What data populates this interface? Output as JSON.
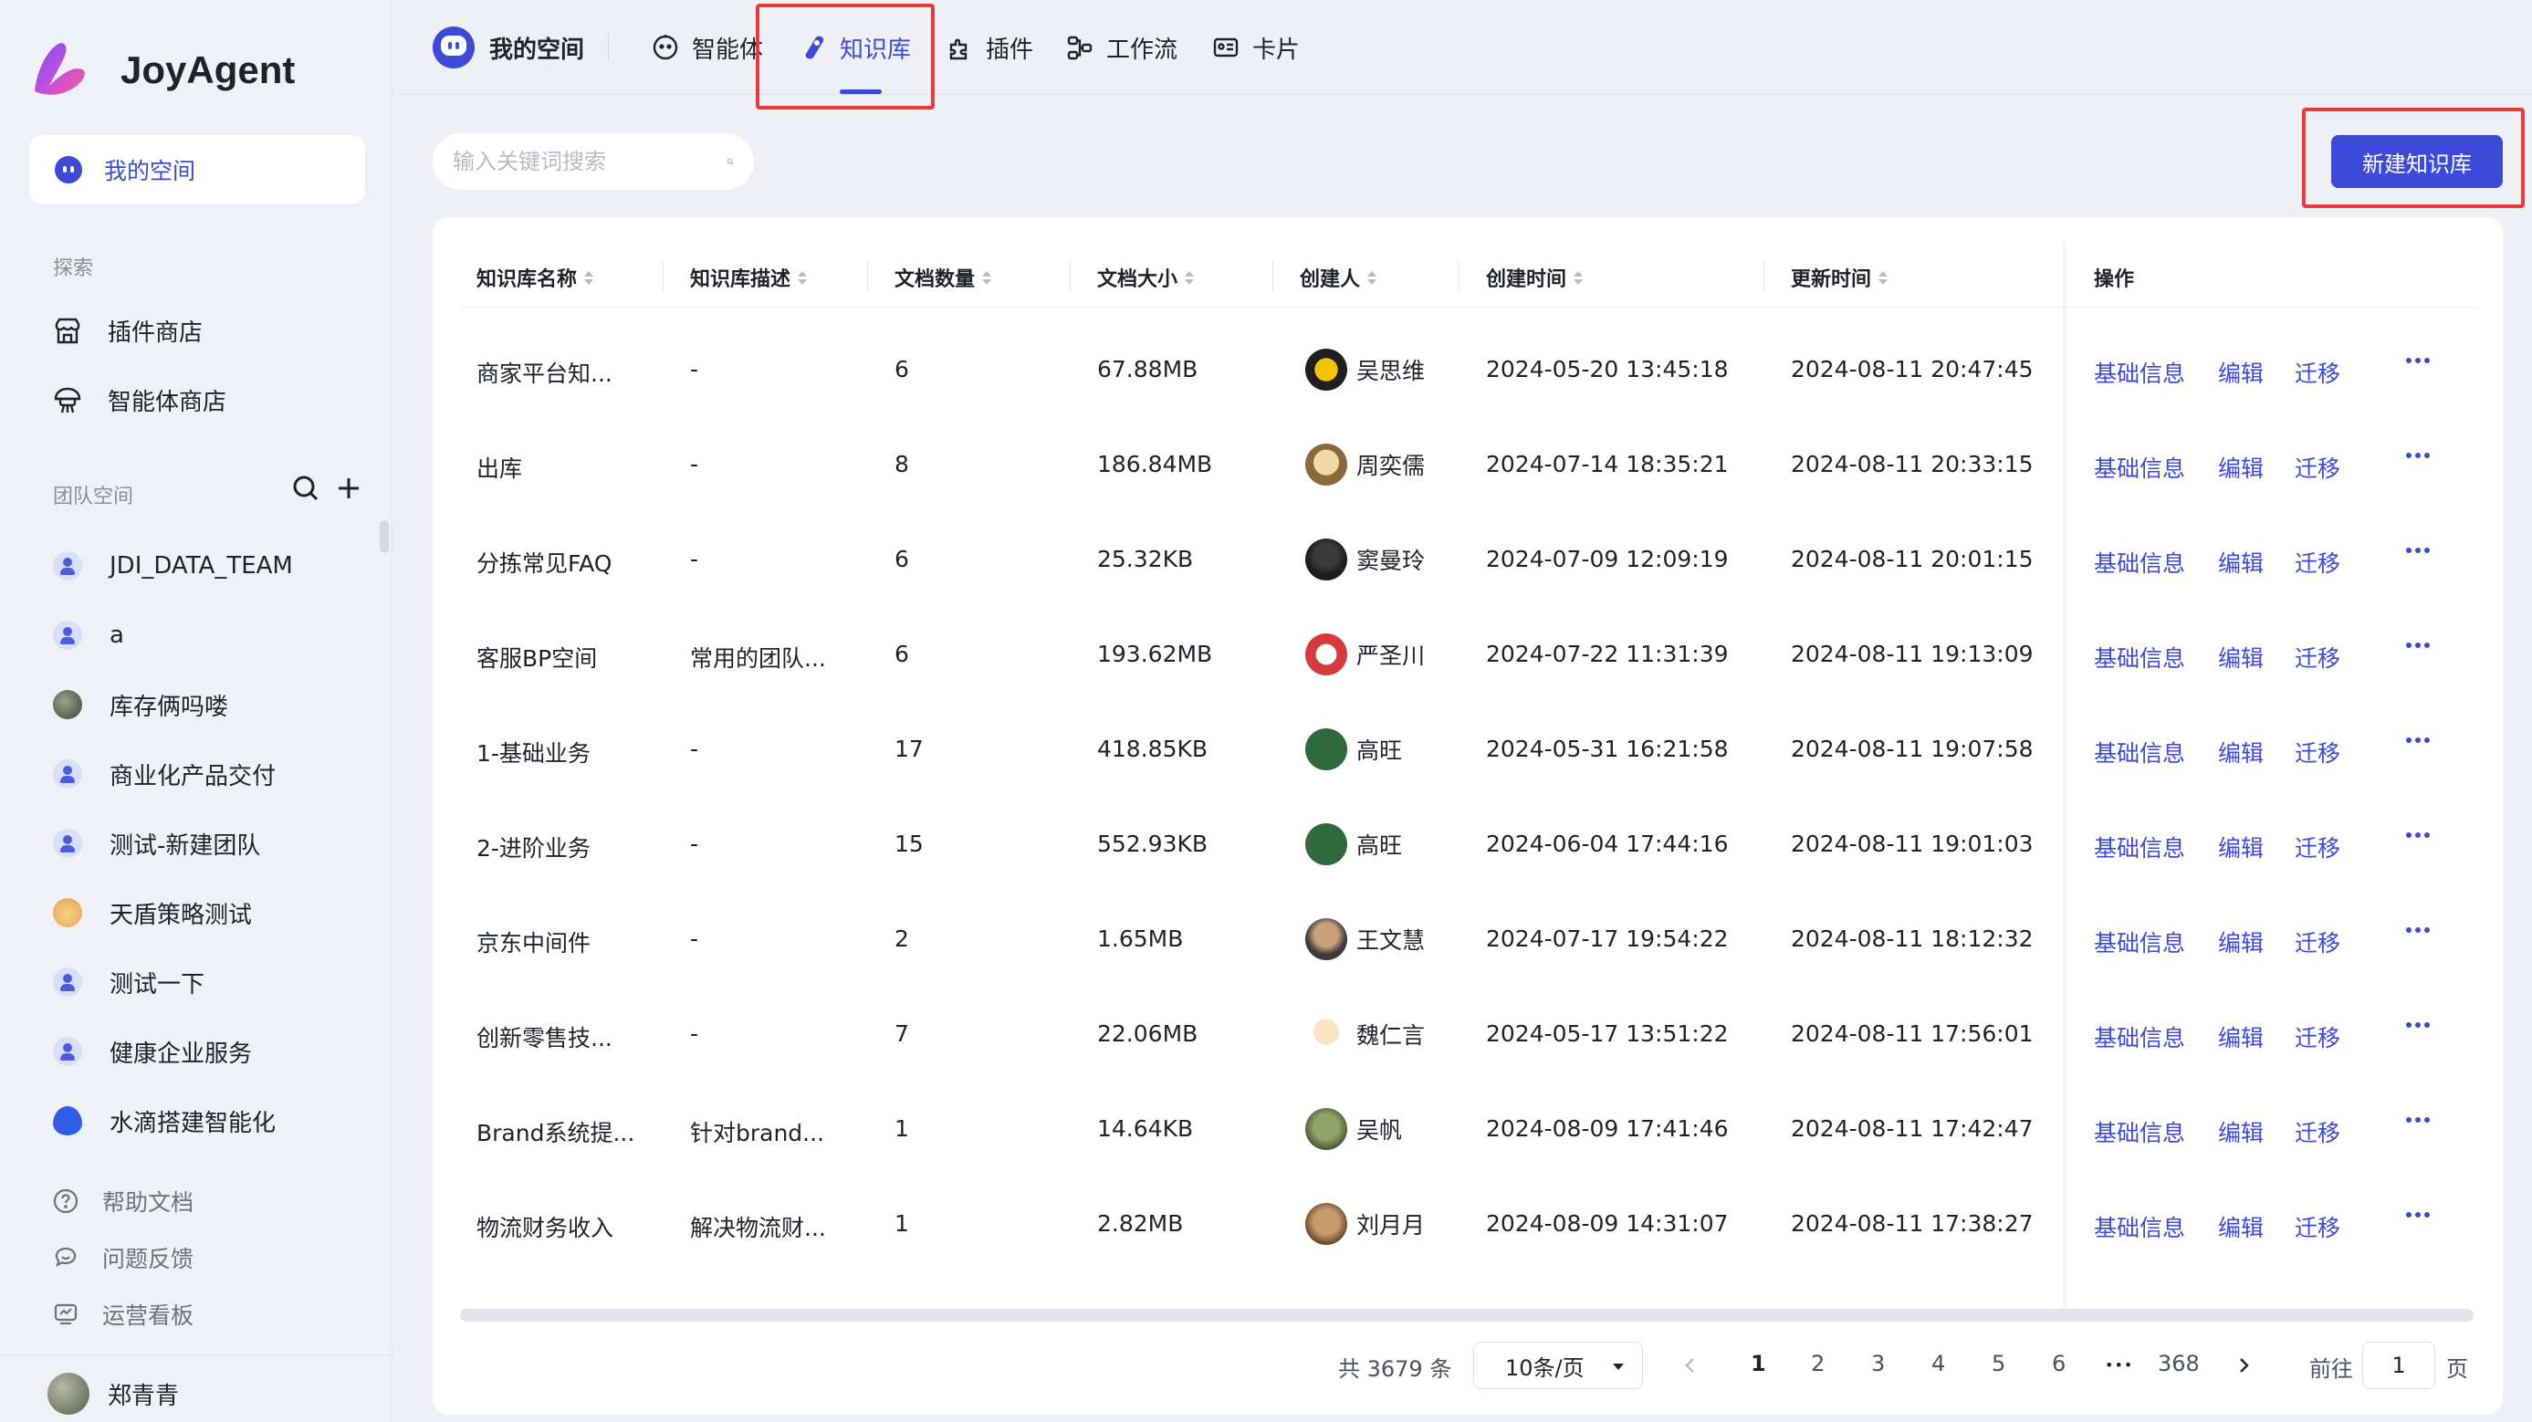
{
  "app": {
    "name": "JoyAgent"
  },
  "sidebar": {
    "my_space": "我的空间",
    "explore_title": "探索",
    "explore_items": [
      {
        "label": "插件商店",
        "icon": "store-icon"
      },
      {
        "label": "智能体商店",
        "icon": "agent-store-icon"
      }
    ],
    "team_title": "团队空间",
    "teams": [
      {
        "label": "JDI_DATA_TEAM",
        "avatar": "user"
      },
      {
        "label": "a",
        "avatar": "user"
      },
      {
        "label": "库存俩吗喽",
        "avatar": "photo"
      },
      {
        "label": "商业化产品交付",
        "avatar": "user"
      },
      {
        "label": "测试-新建团队",
        "avatar": "user"
      },
      {
        "label": "天盾策略测试",
        "avatar": "cat"
      },
      {
        "label": "测试一下",
        "avatar": "user"
      },
      {
        "label": "健康企业服务",
        "avatar": "user"
      },
      {
        "label": "水滴搭建智能化",
        "avatar": "drop"
      }
    ],
    "bottom": [
      {
        "label": "帮助文档",
        "icon": "help-icon"
      },
      {
        "label": "问题反馈",
        "icon": "feedback-icon"
      },
      {
        "label": "运营看板",
        "icon": "dashboard-icon"
      }
    ],
    "user_name": "郑青青"
  },
  "topnav": {
    "title": "我的空间",
    "tabs": [
      {
        "label": "智能体",
        "icon": "agent-icon"
      },
      {
        "label": "知识库",
        "icon": "knowledge-icon"
      },
      {
        "label": "插件",
        "icon": "plugin-icon"
      },
      {
        "label": "工作流",
        "icon": "workflow-icon"
      },
      {
        "label": "卡片",
        "icon": "card-icon"
      }
    ],
    "active_tab": "知识库"
  },
  "toolbar": {
    "search_placeholder": "输入关键词搜索",
    "new_button": "新建知识库"
  },
  "table": {
    "columns": [
      "知识库名称",
      "知识库描述",
      "文档数量",
      "文档大小",
      "创建人",
      "创建时间",
      "更新时间",
      "操作"
    ],
    "actions": [
      "基础信息",
      "编辑",
      "迁移"
    ],
    "rows": [
      {
        "name": "商家平台知...",
        "desc": "-",
        "count": "6",
        "size": "67.88MB",
        "creator": "吴思维",
        "created": "2024-05-20 13:45:18",
        "updated": "2024-08-11 20:47:45"
      },
      {
        "name": "出库",
        "desc": "-",
        "count": "8",
        "size": "186.84MB",
        "creator": "周奕儒",
        "created": "2024-07-14 18:35:21",
        "updated": "2024-08-11 20:33:15"
      },
      {
        "name": "分拣常见FAQ",
        "desc": "-",
        "count": "6",
        "size": "25.32KB",
        "creator": "窦曼玲",
        "created": "2024-07-09 12:09:19",
        "updated": "2024-08-11 20:01:15"
      },
      {
        "name": "客服BP空间",
        "desc": "常用的团队...",
        "count": "6",
        "size": "193.62MB",
        "creator": "严圣川",
        "created": "2024-07-22 11:31:39",
        "updated": "2024-08-11 19:13:09"
      },
      {
        "name": "1-基础业务",
        "desc": "-",
        "count": "17",
        "size": "418.85KB",
        "creator": "高旺",
        "created": "2024-05-31 16:21:58",
        "updated": "2024-08-11 19:07:58"
      },
      {
        "name": "2-进阶业务",
        "desc": "-",
        "count": "15",
        "size": "552.93KB",
        "creator": "高旺",
        "created": "2024-06-04 17:44:16",
        "updated": "2024-08-11 19:01:03"
      },
      {
        "name": "京东中间件",
        "desc": "-",
        "count": "2",
        "size": "1.65MB",
        "creator": "王文慧",
        "created": "2024-07-17 19:54:22",
        "updated": "2024-08-11 18:12:32"
      },
      {
        "name": "创新零售技...",
        "desc": "-",
        "count": "7",
        "size": "22.06MB",
        "creator": "魏仁言",
        "created": "2024-05-17 13:51:22",
        "updated": "2024-08-11 17:56:01"
      },
      {
        "name": "Brand系统提...",
        "desc": "针对brand...",
        "count": "1",
        "size": "14.64KB",
        "creator": "吴帆",
        "created": "2024-08-09 17:41:46",
        "updated": "2024-08-11 17:42:47"
      },
      {
        "name": "物流财务收入",
        "desc": "解决物流财...",
        "count": "1",
        "size": "2.82MB",
        "creator": "刘月月",
        "created": "2024-08-09 14:31:07",
        "updated": "2024-08-11 17:38:27"
      }
    ]
  },
  "pagination": {
    "total": "共 3679 条",
    "page_size": "10条/页",
    "pages": [
      "1",
      "2",
      "3",
      "4",
      "5",
      "6"
    ],
    "ellipsis": "•••",
    "last_page": "368",
    "current": "1",
    "goto_label": "前往",
    "goto_value": "1",
    "page_suffix": "页"
  },
  "colors": {
    "accent": "#3b4ad8",
    "highlight": "#e63b3b"
  }
}
